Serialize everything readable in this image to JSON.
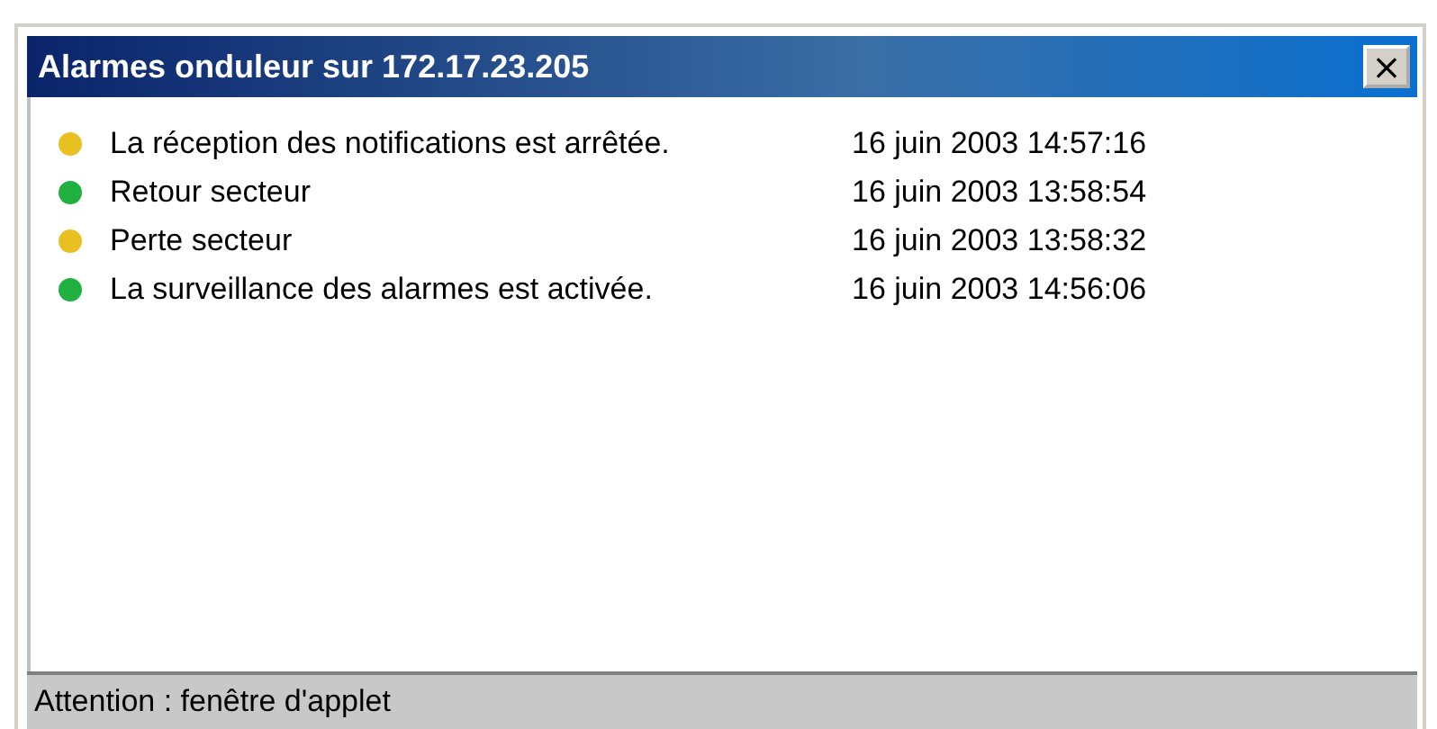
{
  "window": {
    "title": "Alarmes onduleur sur 172.17.23.205",
    "close": "×"
  },
  "alarms": [
    {
      "message": "La réception des notifications est arrêtée.",
      "time": "16 juin 2003 14:57:16",
      "color": "#e8c020"
    },
    {
      "message": "Retour secteur",
      "time": "16 juin 2003 13:58:54",
      "color": "#20b040"
    },
    {
      "message": "Perte secteur",
      "time": "16 juin 2003 13:58:32",
      "color": "#e8c020"
    },
    {
      "message": "La surveillance des alarmes est activée.",
      "time": "16 juin 2003 14:56:06",
      "color": "#20b040"
    }
  ],
  "status_bar": "Attention : fenêtre d'applet"
}
